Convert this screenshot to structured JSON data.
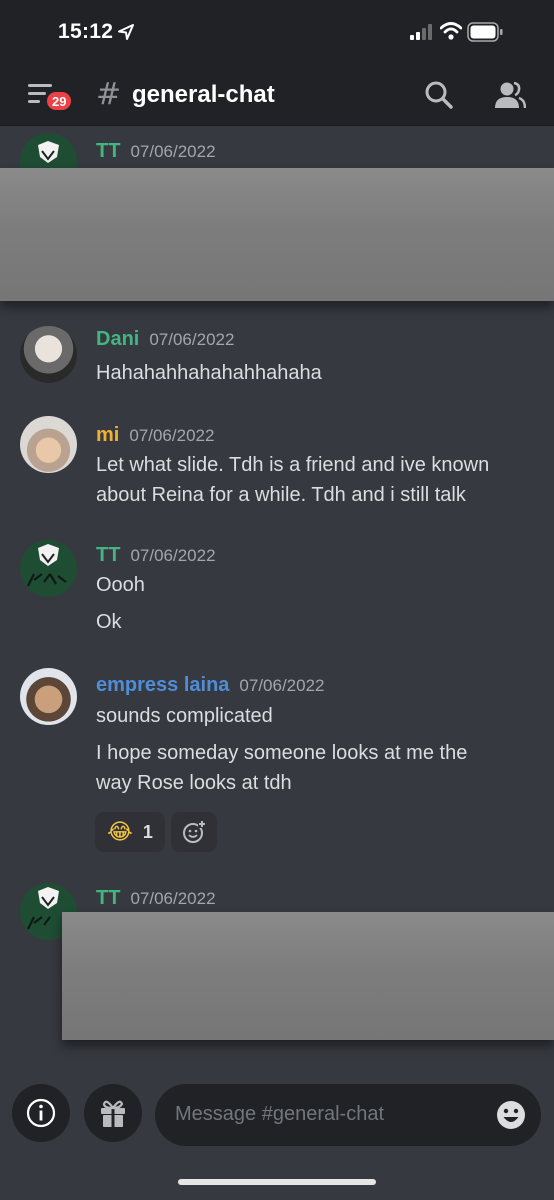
{
  "status_bar": {
    "time": "15:12"
  },
  "header": {
    "unread_badge": "29",
    "hash_symbol": "#",
    "channel_name": "general-chat"
  },
  "messages": [
    {
      "author": "TT",
      "author_color": "#43b581",
      "timestamp": "07/06/2022",
      "lines": [],
      "avatar": "tt-logo-avatar",
      "redacted": true
    },
    {
      "author": "Dani",
      "author_color": "#43b581",
      "timestamp": "07/06/2022",
      "lines": [
        "Hahahahhahahahhahaha"
      ],
      "avatar": "photo-avatar"
    },
    {
      "author": "mi",
      "author_color": "#f0b132",
      "timestamp": "07/06/2022",
      "lines": [
        "Let what slide. Tdh is a friend and ive known",
        "about Reina for a while. Tdh and i still talk"
      ],
      "avatar": "photo-avatar"
    },
    {
      "author": "TT",
      "author_color": "#43b581",
      "timestamp": "07/06/2022",
      "lines": [
        "Oooh",
        "Ok"
      ],
      "avatar": "tt-logo-avatar"
    },
    {
      "author": "empress laina",
      "author_color": "#4f8ed6",
      "timestamp": "07/06/2022",
      "lines": [
        "sounds complicated",
        "I hope someday someone looks at me the",
        "way Rose looks at tdh"
      ],
      "avatar": "photo-avatar",
      "reaction": {
        "emoji": "😂",
        "count": "1",
        "add_icon": "add-reaction-icon"
      }
    },
    {
      "author": "TT",
      "author_color": "#43b581",
      "timestamp": "07/06/2022",
      "lines": [],
      "avatar": "tt-logo-avatar",
      "redacted": true
    }
  ],
  "input": {
    "placeholder": "Message #general-chat"
  },
  "icons": {
    "left": "info-icon",
    "gift": "gift-icon",
    "emoji": "emoji-icon"
  },
  "colors": {
    "background": "#36393f",
    "header": "#202225",
    "accent_red": "#ed4245"
  }
}
